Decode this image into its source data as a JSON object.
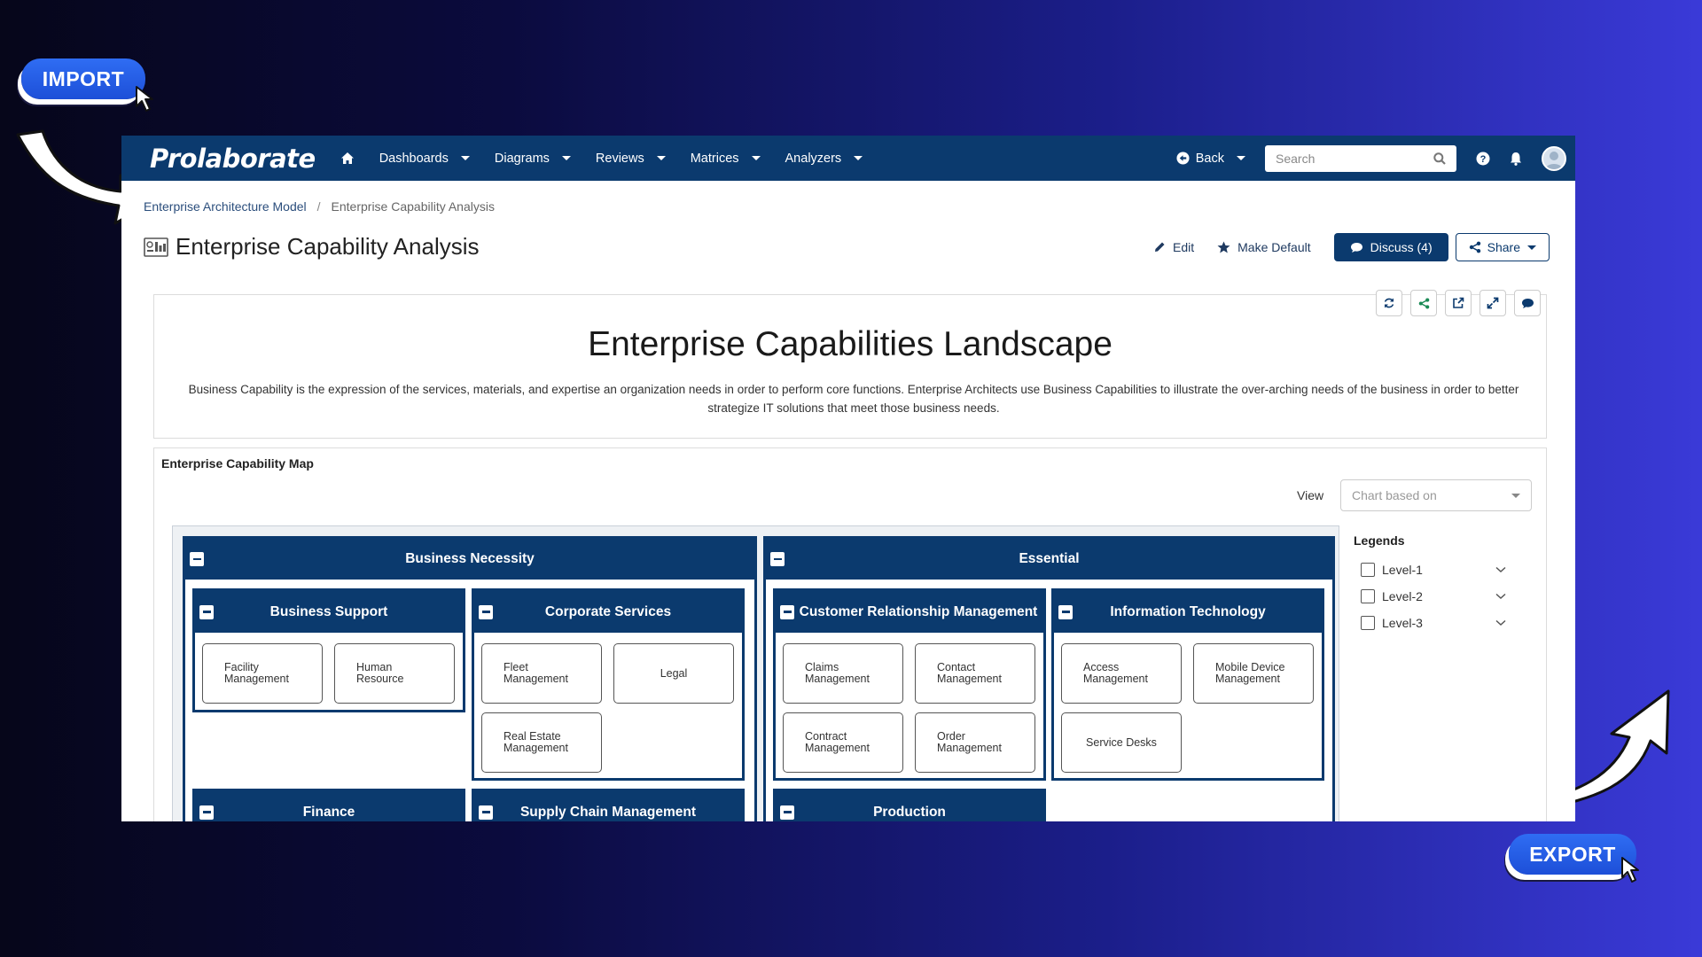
{
  "promo": {
    "import_label": "IMPORT",
    "export_label": "EXPORT"
  },
  "navbar": {
    "logo": "Prolaborate",
    "menu": [
      "Dashboards",
      "Diagrams",
      "Reviews",
      "Matrices",
      "Analyzers"
    ],
    "back_label": "Back",
    "search_placeholder": "Search"
  },
  "breadcrumb": {
    "parent": "Enterprise Architecture Model",
    "current": "Enterprise Capability Analysis"
  },
  "page": {
    "title": "Enterprise Capability Analysis",
    "edit_label": "Edit",
    "make_default_label": "Make Default",
    "discuss_label": "Discuss (4)",
    "share_label": "Share"
  },
  "landscape": {
    "title": "Enterprise Capabilities Landscape",
    "description": "Business Capability is the expression of the services, materials, and expertise an organization needs in order to perform core functions. Enterprise Architects use Business Capabilities to illustrate the over-arching needs of the business in order to better strategize IT solutions that meet those business needs."
  },
  "map": {
    "label": "Enterprise Capability Map",
    "view_label": "View",
    "view_value": "Chart based on",
    "legends_title": "Legends",
    "legends": [
      "Level-1",
      "Level-2",
      "Level-3"
    ],
    "groups": [
      {
        "name": "Business Necessity",
        "children": [
          {
            "name": "Business Support",
            "items": [
              "Facility Management",
              "Human Resource"
            ]
          },
          {
            "name": "Corporate Services",
            "items": [
              "Fleet Management",
              "Legal",
              "Real Estate Management"
            ]
          },
          {
            "name": "Finance",
            "items": []
          },
          {
            "name": "Supply Chain Management",
            "items": []
          }
        ]
      },
      {
        "name": "Essential",
        "children": [
          {
            "name": "Customer Relationship Management",
            "items": [
              "Claims Management",
              "Contact Management",
              "Contract Management",
              "Order Management"
            ]
          },
          {
            "name": "Information Technology",
            "items": [
              "Access Management",
              "Mobile Device Management",
              "Service Desks"
            ]
          },
          {
            "name": "Production",
            "items": []
          }
        ]
      }
    ]
  },
  "colors": {
    "navy": "#0b3a6e",
    "promo_blue": "#1d4fd8"
  }
}
